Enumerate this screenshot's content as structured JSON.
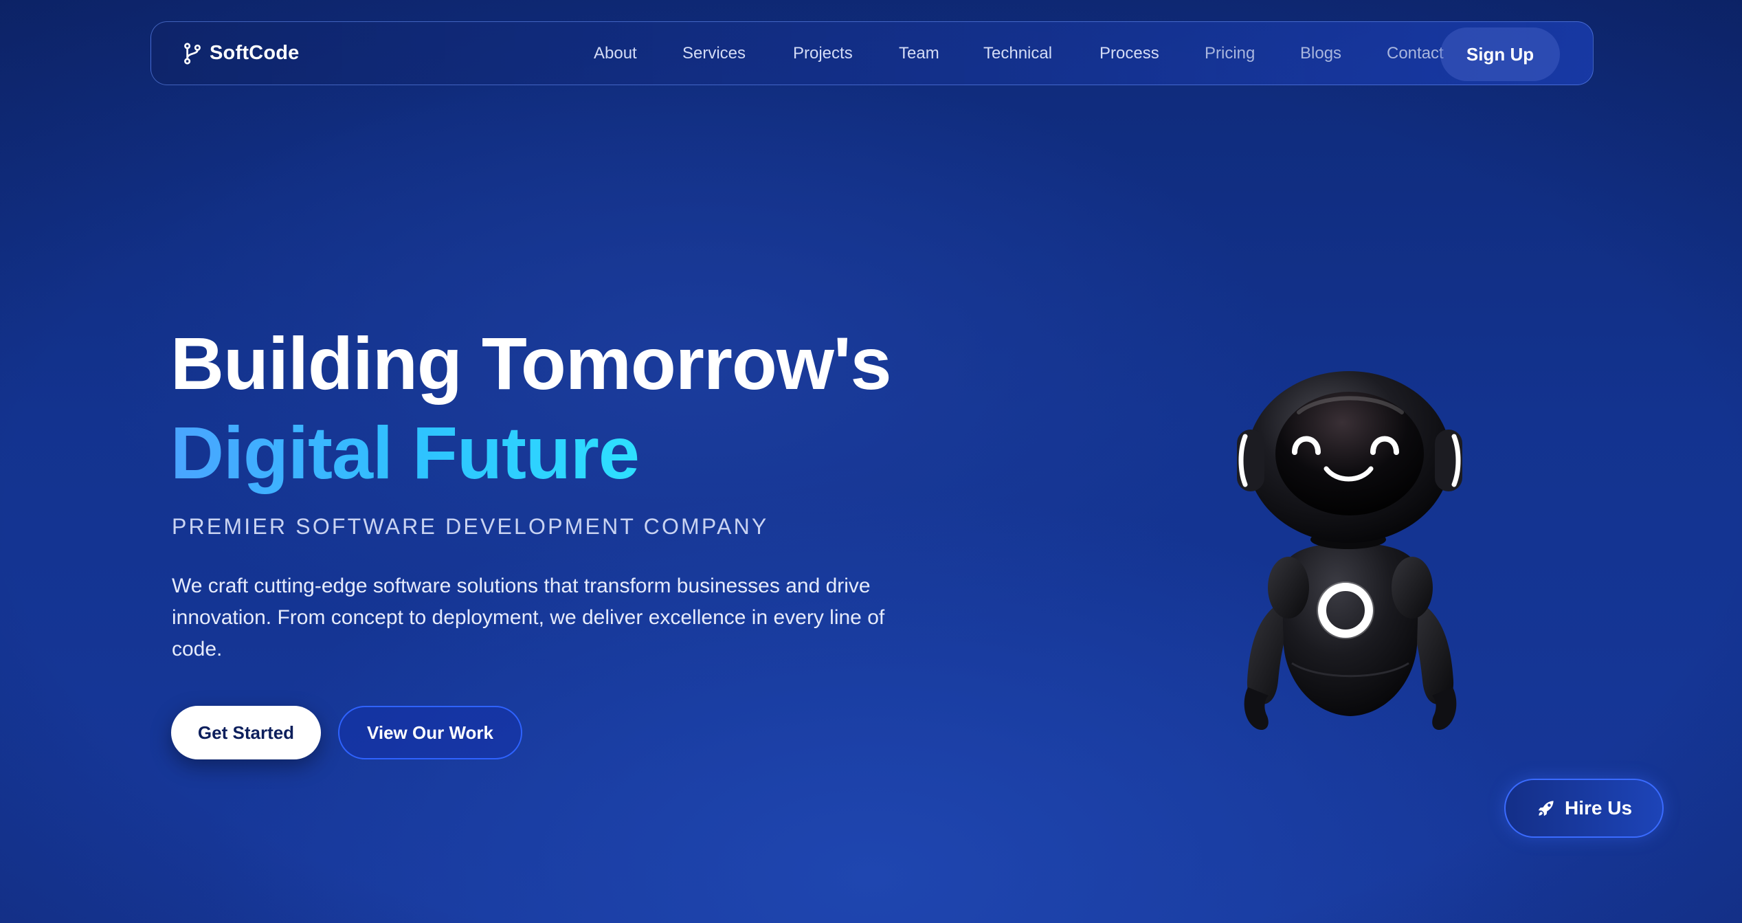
{
  "brand": {
    "name": "SoftCode",
    "icon": "git-branch-icon"
  },
  "nav": {
    "links": [
      "About",
      "Services",
      "Projects",
      "Team",
      "Technical",
      "Process",
      "Pricing",
      "Blogs",
      "Contact"
    ],
    "signup_label": "Sign Up"
  },
  "hero": {
    "title_line1": "Building Tomorrow's",
    "title_line2": "Digital Future",
    "subtitle": "PREMIER SOFTWARE DEVELOPMENT COMPANY",
    "description": "We craft cutting-edge software solutions that transform businesses and drive innovation. From concept to deployment, we deliver excellence in every line of code.",
    "primary_cta": "Get Started",
    "secondary_cta": "View Our Work"
  },
  "mascot": {
    "name": "robot-mascot"
  },
  "hire": {
    "label": "Hire Us",
    "icon": "rocket-icon"
  },
  "colors": {
    "background": "#13338f",
    "accent_gradient_start": "#4aa4ff",
    "accent_gradient_end": "#2ee0ff",
    "button_border": "#2f63ff"
  }
}
